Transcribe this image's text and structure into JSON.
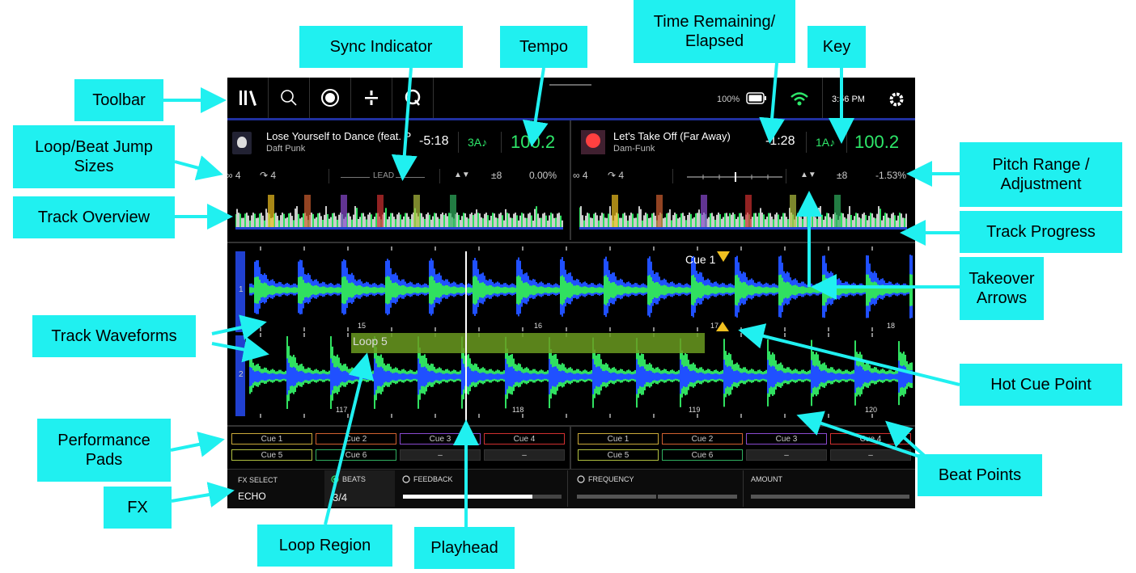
{
  "callouts": {
    "toolbar": "Toolbar",
    "sync_indicator": "Sync Indicator",
    "tempo": "Tempo",
    "time_remaining": "Time Remaining/ Elapsed",
    "key": "Key",
    "loop_beat_jump": "Loop/Beat Jump Sizes",
    "pitch_range": "Pitch Range / Adjustment",
    "track_overview": "Track Overview",
    "track_progress": "Track Progress",
    "takeover_arrows": "Takeover Arrows",
    "track_waveforms": "Track Waveforms",
    "hot_cue_point": "Hot Cue Point",
    "performance_pads": "Performance Pads",
    "beat_points": "Beat Points",
    "fx": "FX",
    "loop_region": "Loop Region",
    "playhead": "Playhead"
  },
  "status": {
    "battery": "100%",
    "clock": "3:56 PM"
  },
  "deck_left": {
    "title": "Lose Yourself to Dance (feat. Pharrell Williams)",
    "artist": "Daft Punk",
    "time": "-5:18",
    "key": "3A♪",
    "bpm": "100.2",
    "loop_size": "4",
    "jump_size": "4",
    "sync_label": "LEAD",
    "pitch_range": "±8",
    "pitch": "0.00%"
  },
  "deck_right": {
    "title": "Let's Take Off (Far Away)",
    "artist": "Dam-Funk",
    "time": "-1:28",
    "key": "1A♪",
    "bpm": "100.2",
    "loop_size": "4",
    "jump_size": "4",
    "pitch_range": "±8",
    "pitch": "-1.53%"
  },
  "waveform": {
    "deck1_number": "1",
    "deck2_number": "2",
    "cue_label": "Cue 1",
    "loop_label": "Loop 5",
    "beats_top": [
      "15",
      "16",
      "17",
      "18"
    ],
    "beats_bottom": [
      "117",
      "118",
      "119",
      "120"
    ]
  },
  "pads_left": [
    {
      "label": "Cue 1",
      "color": "#c9a93a"
    },
    {
      "label": "Cue 2",
      "color": "#d06030"
    },
    {
      "label": "Cue 3",
      "color": "#8a4ad0"
    },
    {
      "label": "Cue 4",
      "color": "#d03030"
    },
    {
      "label": "Cue 5",
      "color": "#b0c040"
    },
    {
      "label": "Cue 6",
      "color": "#30b060"
    },
    {
      "label": "–",
      "color": "#333333"
    },
    {
      "label": "–",
      "color": "#333333"
    }
  ],
  "pads_right": [
    {
      "label": "Cue 1",
      "color": "#c9a93a"
    },
    {
      "label": "Cue 2",
      "color": "#d06030"
    },
    {
      "label": "Cue 3",
      "color": "#8a4ad0"
    },
    {
      "label": "Cue 4",
      "color": "#d03030"
    },
    {
      "label": "Cue 5",
      "color": "#b0c040"
    },
    {
      "label": "Cue 6",
      "color": "#30b060"
    },
    {
      "label": "–",
      "color": "#333333"
    },
    {
      "label": "–",
      "color": "#333333"
    }
  ],
  "fx": {
    "select_label": "FX SELECT",
    "effect": "ECHO",
    "beats_label": "BEATS",
    "beats_value": "3/4",
    "feedback_label": "FEEDBACK",
    "frequency_label": "FREQUENCY",
    "amount_label": "AMOUNT"
  },
  "colors": {
    "callout_bg": "#20f0f0",
    "arrow": "#20f0f0",
    "bpm_green": "#2ee86a",
    "wave_blue": "#2050ff",
    "wave_green": "#30e060",
    "loop_region": "#6a9a20"
  }
}
